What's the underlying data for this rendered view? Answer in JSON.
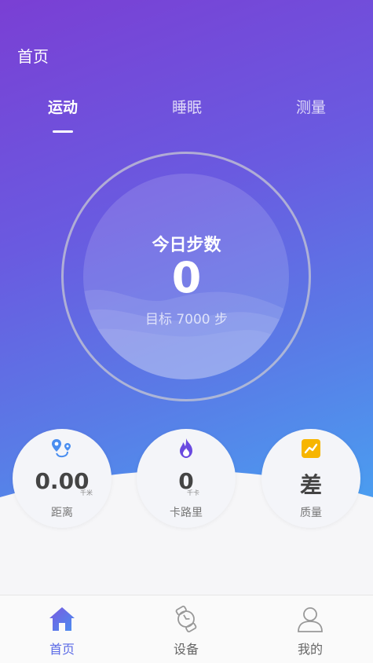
{
  "header": {
    "title": "首页"
  },
  "tabs": [
    {
      "label": "运动",
      "active": true
    },
    {
      "label": "睡眠",
      "active": false
    },
    {
      "label": "测量",
      "active": false
    }
  ],
  "steps": {
    "title": "今日步数",
    "value": "0",
    "goal": "目标 7000 步"
  },
  "stats": [
    {
      "value": "0.00",
      "unit": "千米",
      "label": "距离",
      "icon": "location-route-icon"
    },
    {
      "value": "0",
      "unit": "千卡",
      "label": "卡路里",
      "icon": "flame-icon"
    },
    {
      "value": "差",
      "unit": "",
      "label": "质量",
      "icon": "trend-chart-icon"
    }
  ],
  "nav": [
    {
      "label": "首页",
      "icon": "home-icon",
      "active": true
    },
    {
      "label": "设备",
      "icon": "watch-icon",
      "active": false
    },
    {
      "label": "我的",
      "icon": "user-icon",
      "active": false
    }
  ],
  "colors": {
    "gradient_start": "#7a3fd4",
    "gradient_end": "#4a9ef0",
    "accent": "#5a6ae6",
    "flame": "#6a4ae0",
    "quality_badge": "#f7b500"
  }
}
